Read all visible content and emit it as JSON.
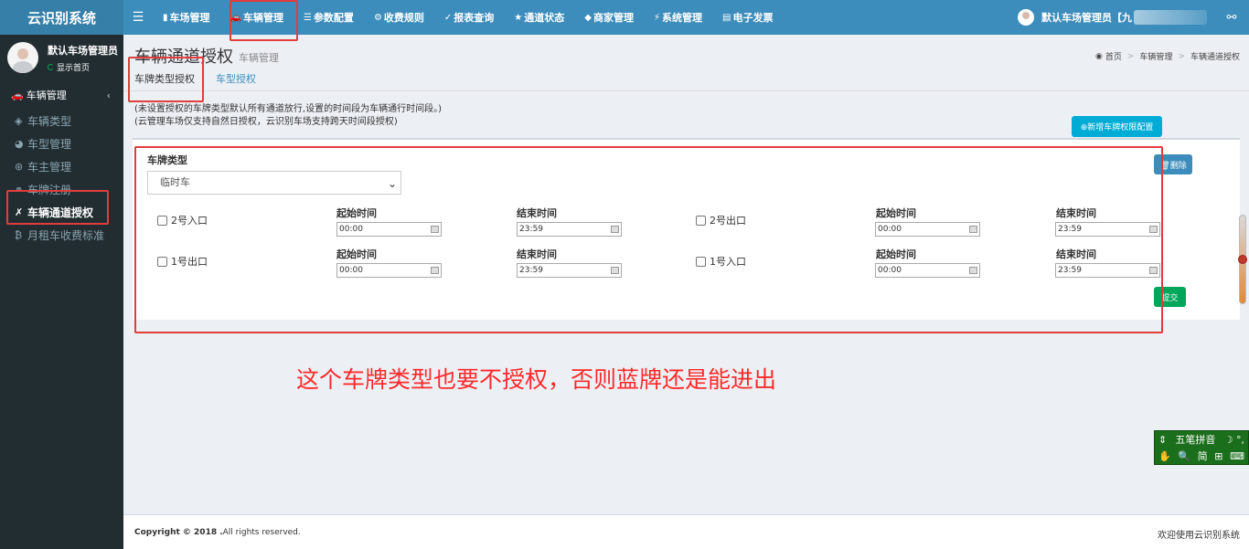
{
  "app": {
    "logo": "云识别系统"
  },
  "header": {
    "toggle_icon": "☰",
    "nav": [
      {
        "icon": "▮",
        "label": "车场管理"
      },
      {
        "icon": "🚗",
        "label": "车辆管理"
      },
      {
        "icon": "☰",
        "label": "参数配置"
      },
      {
        "icon": "⚙",
        "label": "收费规则"
      },
      {
        "icon": "✓",
        "label": "报表查询"
      },
      {
        "icon": "★",
        "label": "通道状态"
      },
      {
        "icon": "◆",
        "label": "商家管理"
      },
      {
        "icon": "⚡",
        "label": "系统管理"
      },
      {
        "icon": "▤",
        "label": "电子发票"
      }
    ],
    "user_label": "默认车场管理员【九",
    "share_icon": "⚯"
  },
  "sidebar": {
    "user_name": "默认车场管理员",
    "user_status": "显示首页",
    "section_icon": "🚗",
    "section_label": "车辆管理",
    "section_chevron": "‹",
    "items": [
      {
        "icon": "◈",
        "label": "车辆类型"
      },
      {
        "icon": "◕",
        "label": "车型管理"
      },
      {
        "icon": "⊛",
        "label": "车主管理"
      },
      {
        "icon": "⚭",
        "label": "车牌注册"
      },
      {
        "icon": "✗",
        "label": "车辆通道授权"
      },
      {
        "icon": "₿",
        "label": "月租车收费标准"
      }
    ]
  },
  "page": {
    "title": "车辆通道授权",
    "subtitle": "车辆管理",
    "breadcrumb": {
      "icon": "◉",
      "home": "首页",
      "sep": ">",
      "level1": "车辆管理",
      "level2": "车辆通道授权"
    },
    "tabs": [
      "车牌类型授权",
      "车型授权"
    ],
    "notes": [
      "(未设置授权的车牌类型默认所有通道放行,设置的时间段为车辆通行时间段。)",
      "(云管理车场仅支持自然日授权，云识别车场支持跨天时间段授权)"
    ],
    "add_button": "⊕新增车牌权限配置",
    "plate_type_label": "车牌类型",
    "plate_type_value": "临时车",
    "select_caret": "⌄",
    "delete_button": "🗑删除",
    "submit_button": "提交",
    "start_label": "起始时间",
    "end_label": "结束时间",
    "channels": [
      {
        "name": "2号入口",
        "start": "00:00",
        "end": "23:59"
      },
      {
        "name": "2号出口",
        "start": "00:00",
        "end": "23:59"
      },
      {
        "name": "1号出口",
        "start": "00:00",
        "end": "23:59"
      },
      {
        "name": "1号入口",
        "start": "00:00",
        "end": "23:59"
      }
    ]
  },
  "annotation": "这个车牌类型也要不授权，否则蓝牌还是能进出",
  "footer": {
    "copyright_bold": "Copyright © 2018 .",
    "copyright_rest": "All rights reserved.",
    "right": "欢迎使用云识别系统"
  },
  "ime": {
    "row1_left": "⇕",
    "row1_label": "五笔拼音",
    "row1_right": "☽ °,",
    "row2": [
      "✋",
      "🔍",
      "简",
      "⊞",
      "⌨"
    ]
  },
  "colors": {
    "header": "#3c8dbc",
    "sidebar": "#222d32",
    "highlight": "#e23c3c",
    "annotation": "#ff2a2a"
  }
}
